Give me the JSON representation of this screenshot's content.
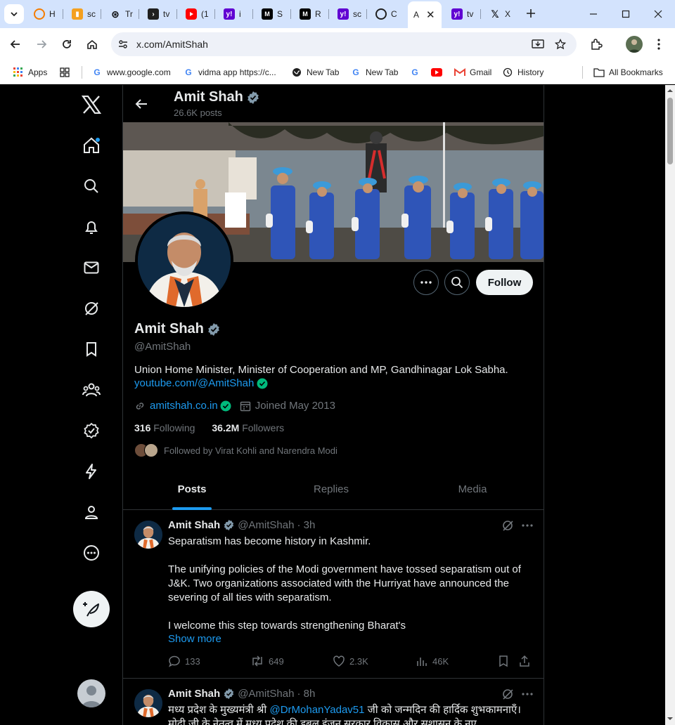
{
  "browser": {
    "tabs": [
      {
        "label": "H",
        "icon": "orange-ring-icon"
      },
      {
        "label": "sc",
        "icon": "book-icon"
      },
      {
        "label": "Tr",
        "icon": "openai-icon"
      },
      {
        "label": "tv",
        "icon": "terminal-icon"
      },
      {
        "label": "(1",
        "icon": "youtube-icon"
      },
      {
        "label": "i",
        "icon": "yahoo-icon"
      },
      {
        "label": "S",
        "icon": "medium-icon"
      },
      {
        "label": "R",
        "icon": "medium-icon"
      },
      {
        "label": "sc",
        "icon": "yahoo-icon"
      },
      {
        "label": "C",
        "icon": "github-icon"
      },
      {
        "label": "A",
        "icon": "x-icon",
        "active": true
      },
      {
        "label": "tv",
        "icon": "yahoo-icon"
      },
      {
        "label": "X",
        "icon": "x-icon"
      }
    ],
    "url": "x.com/AmitShah",
    "bookmarks": [
      {
        "label": "Apps"
      },
      {
        "label": ""
      },
      {
        "label": "www.google.com"
      },
      {
        "label": "vidma app https://c..."
      },
      {
        "label": "New Tab"
      },
      {
        "label": "New Tab"
      },
      {
        "label": ""
      },
      {
        "label": ""
      },
      {
        "label": "Gmail"
      },
      {
        "label": "History"
      },
      {
        "label": "All Bookmarks"
      }
    ]
  },
  "profile": {
    "name": "Amit Shah",
    "posts_count": "26.6K posts",
    "handle": "@AmitShah",
    "bio": "Union Home Minister, Minister of Cooperation and MP, Gandhinagar Lok Sabha.",
    "bio_link": "youtube.com/@AmitShah",
    "website": "amitshah.co.in",
    "joined": "Joined May 2013",
    "following_count": "316",
    "following_label": "Following",
    "followers_count": "36.2M",
    "followers_label": "Followers",
    "followed_by": "Followed by Virat Kohli and Narendra Modi",
    "follow_label": "Follow"
  },
  "tabs": [
    "Posts",
    "Replies",
    "Media"
  ],
  "tweets": [
    {
      "name": "Amit Shah",
      "handle": "@AmitShah",
      "time": "· 3h",
      "paragraphs": [
        "Separatism has become history in Kashmir.",
        "The unifying policies of the Modi government have tossed separatism out of J&K. Two organizations associated with the Hurriyat have announced the severing of all ties with separatism.",
        "I welcome this step towards strengthening Bharat's"
      ],
      "show_more": "Show more",
      "replies": "133",
      "reposts": "649",
      "likes": "2.3K",
      "views": "46K"
    },
    {
      "name": "Amit Shah",
      "handle": "@AmitShah",
      "time": "· 8h",
      "text_before": "मध्य प्रदेश के मुख्यमंत्री श्री ",
      "mention": "@DrMohanYadav51",
      "text_after": " जी को जन्मदिन की हार्दिक शुभकामनाएँ। मोदी जी के नेतृत्व में मध्य प्रदेश की डबल इंजन सरकार विकास और सुशासन के नए"
    }
  ],
  "colors": {
    "accent": "#1d9bf0",
    "verified": "#1d9bf0",
    "background": "#000000",
    "text": "#e7e9ea",
    "muted": "#71767b"
  }
}
